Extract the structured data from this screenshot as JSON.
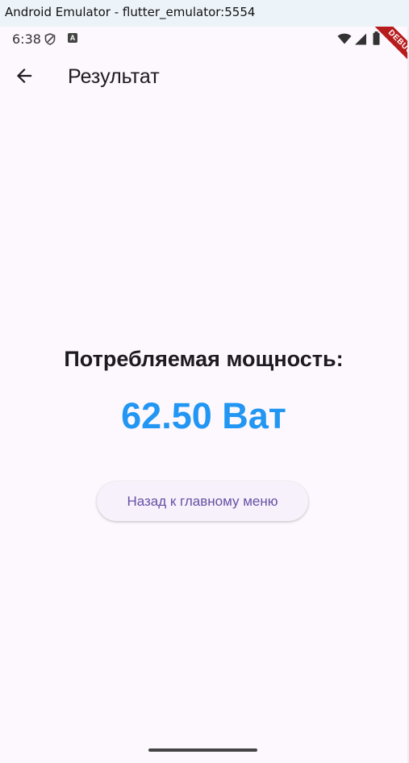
{
  "window": {
    "title": "Android Emulator - flutter_emulator:5554"
  },
  "status_bar": {
    "time": "6:38",
    "icons": [
      "shield-icon",
      "a-notification-icon",
      "wifi-icon",
      "signal-icon",
      "battery-icon"
    ]
  },
  "debug_banner": {
    "label": "DEBUG"
  },
  "app_bar": {
    "back_icon": "arrow-back-icon",
    "title": "Результат"
  },
  "result": {
    "label": "Потребляемая мощность:",
    "value": "62.50 Ват",
    "value_color": "#2196f3"
  },
  "actions": {
    "back_to_menu_label": "Назад к главному меню",
    "accent": "#6750a4"
  }
}
